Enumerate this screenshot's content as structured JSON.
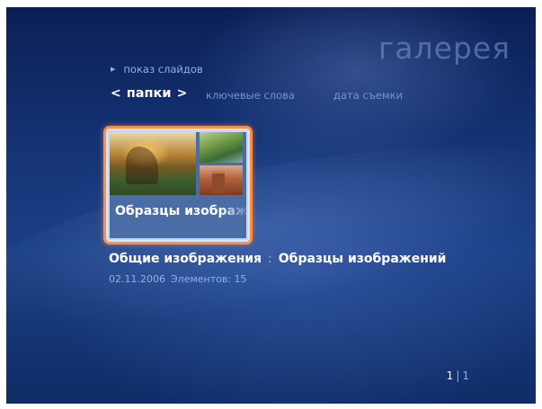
{
  "header": {
    "title": "галерея"
  },
  "slideshow": {
    "label": "показ слайдов"
  },
  "nav": {
    "current": "папки",
    "left_chevron": "<",
    "right_chevron": ">",
    "keywords": "ключевые слова",
    "date": "дата съемки"
  },
  "tile": {
    "caption": "Образцы изображений"
  },
  "details": {
    "path_parent": "Общие изображения",
    "path_separator": ":",
    "path_current": "Образцы изображений",
    "date": "02.11.2006",
    "items_label": "Элементов: 15"
  },
  "pager": {
    "current": "1",
    "separator": "|",
    "total": "1"
  }
}
